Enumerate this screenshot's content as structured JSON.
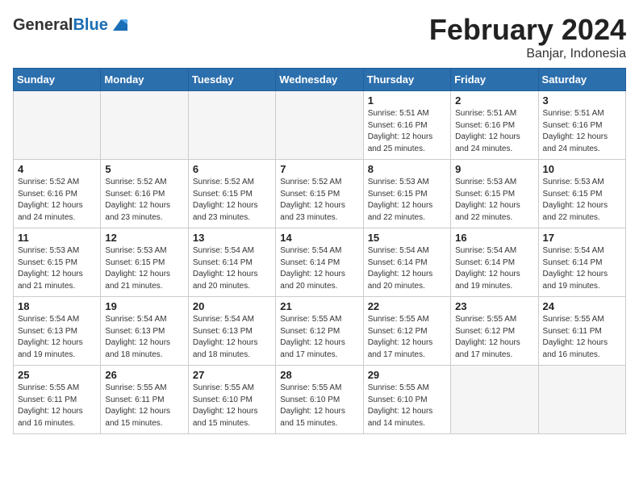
{
  "header": {
    "logo_general": "General",
    "logo_blue": "Blue",
    "main_title": "February 2024",
    "subtitle": "Banjar, Indonesia"
  },
  "days_of_week": [
    "Sunday",
    "Monday",
    "Tuesday",
    "Wednesday",
    "Thursday",
    "Friday",
    "Saturday"
  ],
  "weeks": [
    [
      {
        "day": "",
        "info": ""
      },
      {
        "day": "",
        "info": ""
      },
      {
        "day": "",
        "info": ""
      },
      {
        "day": "",
        "info": ""
      },
      {
        "day": "1",
        "info": "Sunrise: 5:51 AM\nSunset: 6:16 PM\nDaylight: 12 hours\nand 25 minutes."
      },
      {
        "day": "2",
        "info": "Sunrise: 5:51 AM\nSunset: 6:16 PM\nDaylight: 12 hours\nand 24 minutes."
      },
      {
        "day": "3",
        "info": "Sunrise: 5:51 AM\nSunset: 6:16 PM\nDaylight: 12 hours\nand 24 minutes."
      }
    ],
    [
      {
        "day": "4",
        "info": "Sunrise: 5:52 AM\nSunset: 6:16 PM\nDaylight: 12 hours\nand 24 minutes."
      },
      {
        "day": "5",
        "info": "Sunrise: 5:52 AM\nSunset: 6:16 PM\nDaylight: 12 hours\nand 23 minutes."
      },
      {
        "day": "6",
        "info": "Sunrise: 5:52 AM\nSunset: 6:15 PM\nDaylight: 12 hours\nand 23 minutes."
      },
      {
        "day": "7",
        "info": "Sunrise: 5:52 AM\nSunset: 6:15 PM\nDaylight: 12 hours\nand 23 minutes."
      },
      {
        "day": "8",
        "info": "Sunrise: 5:53 AM\nSunset: 6:15 PM\nDaylight: 12 hours\nand 22 minutes."
      },
      {
        "day": "9",
        "info": "Sunrise: 5:53 AM\nSunset: 6:15 PM\nDaylight: 12 hours\nand 22 minutes."
      },
      {
        "day": "10",
        "info": "Sunrise: 5:53 AM\nSunset: 6:15 PM\nDaylight: 12 hours\nand 22 minutes."
      }
    ],
    [
      {
        "day": "11",
        "info": "Sunrise: 5:53 AM\nSunset: 6:15 PM\nDaylight: 12 hours\nand 21 minutes."
      },
      {
        "day": "12",
        "info": "Sunrise: 5:53 AM\nSunset: 6:15 PM\nDaylight: 12 hours\nand 21 minutes."
      },
      {
        "day": "13",
        "info": "Sunrise: 5:54 AM\nSunset: 6:14 PM\nDaylight: 12 hours\nand 20 minutes."
      },
      {
        "day": "14",
        "info": "Sunrise: 5:54 AM\nSunset: 6:14 PM\nDaylight: 12 hours\nand 20 minutes."
      },
      {
        "day": "15",
        "info": "Sunrise: 5:54 AM\nSunset: 6:14 PM\nDaylight: 12 hours\nand 20 minutes."
      },
      {
        "day": "16",
        "info": "Sunrise: 5:54 AM\nSunset: 6:14 PM\nDaylight: 12 hours\nand 19 minutes."
      },
      {
        "day": "17",
        "info": "Sunrise: 5:54 AM\nSunset: 6:14 PM\nDaylight: 12 hours\nand 19 minutes."
      }
    ],
    [
      {
        "day": "18",
        "info": "Sunrise: 5:54 AM\nSunset: 6:13 PM\nDaylight: 12 hours\nand 19 minutes."
      },
      {
        "day": "19",
        "info": "Sunrise: 5:54 AM\nSunset: 6:13 PM\nDaylight: 12 hours\nand 18 minutes."
      },
      {
        "day": "20",
        "info": "Sunrise: 5:54 AM\nSunset: 6:13 PM\nDaylight: 12 hours\nand 18 minutes."
      },
      {
        "day": "21",
        "info": "Sunrise: 5:55 AM\nSunset: 6:12 PM\nDaylight: 12 hours\nand 17 minutes."
      },
      {
        "day": "22",
        "info": "Sunrise: 5:55 AM\nSunset: 6:12 PM\nDaylight: 12 hours\nand 17 minutes."
      },
      {
        "day": "23",
        "info": "Sunrise: 5:55 AM\nSunset: 6:12 PM\nDaylight: 12 hours\nand 17 minutes."
      },
      {
        "day": "24",
        "info": "Sunrise: 5:55 AM\nSunset: 6:11 PM\nDaylight: 12 hours\nand 16 minutes."
      }
    ],
    [
      {
        "day": "25",
        "info": "Sunrise: 5:55 AM\nSunset: 6:11 PM\nDaylight: 12 hours\nand 16 minutes."
      },
      {
        "day": "26",
        "info": "Sunrise: 5:55 AM\nSunset: 6:11 PM\nDaylight: 12 hours\nand 15 minutes."
      },
      {
        "day": "27",
        "info": "Sunrise: 5:55 AM\nSunset: 6:10 PM\nDaylight: 12 hours\nand 15 minutes."
      },
      {
        "day": "28",
        "info": "Sunrise: 5:55 AM\nSunset: 6:10 PM\nDaylight: 12 hours\nand 15 minutes."
      },
      {
        "day": "29",
        "info": "Sunrise: 5:55 AM\nSunset: 6:10 PM\nDaylight: 12 hours\nand 14 minutes."
      },
      {
        "day": "",
        "info": ""
      },
      {
        "day": "",
        "info": ""
      }
    ]
  ]
}
